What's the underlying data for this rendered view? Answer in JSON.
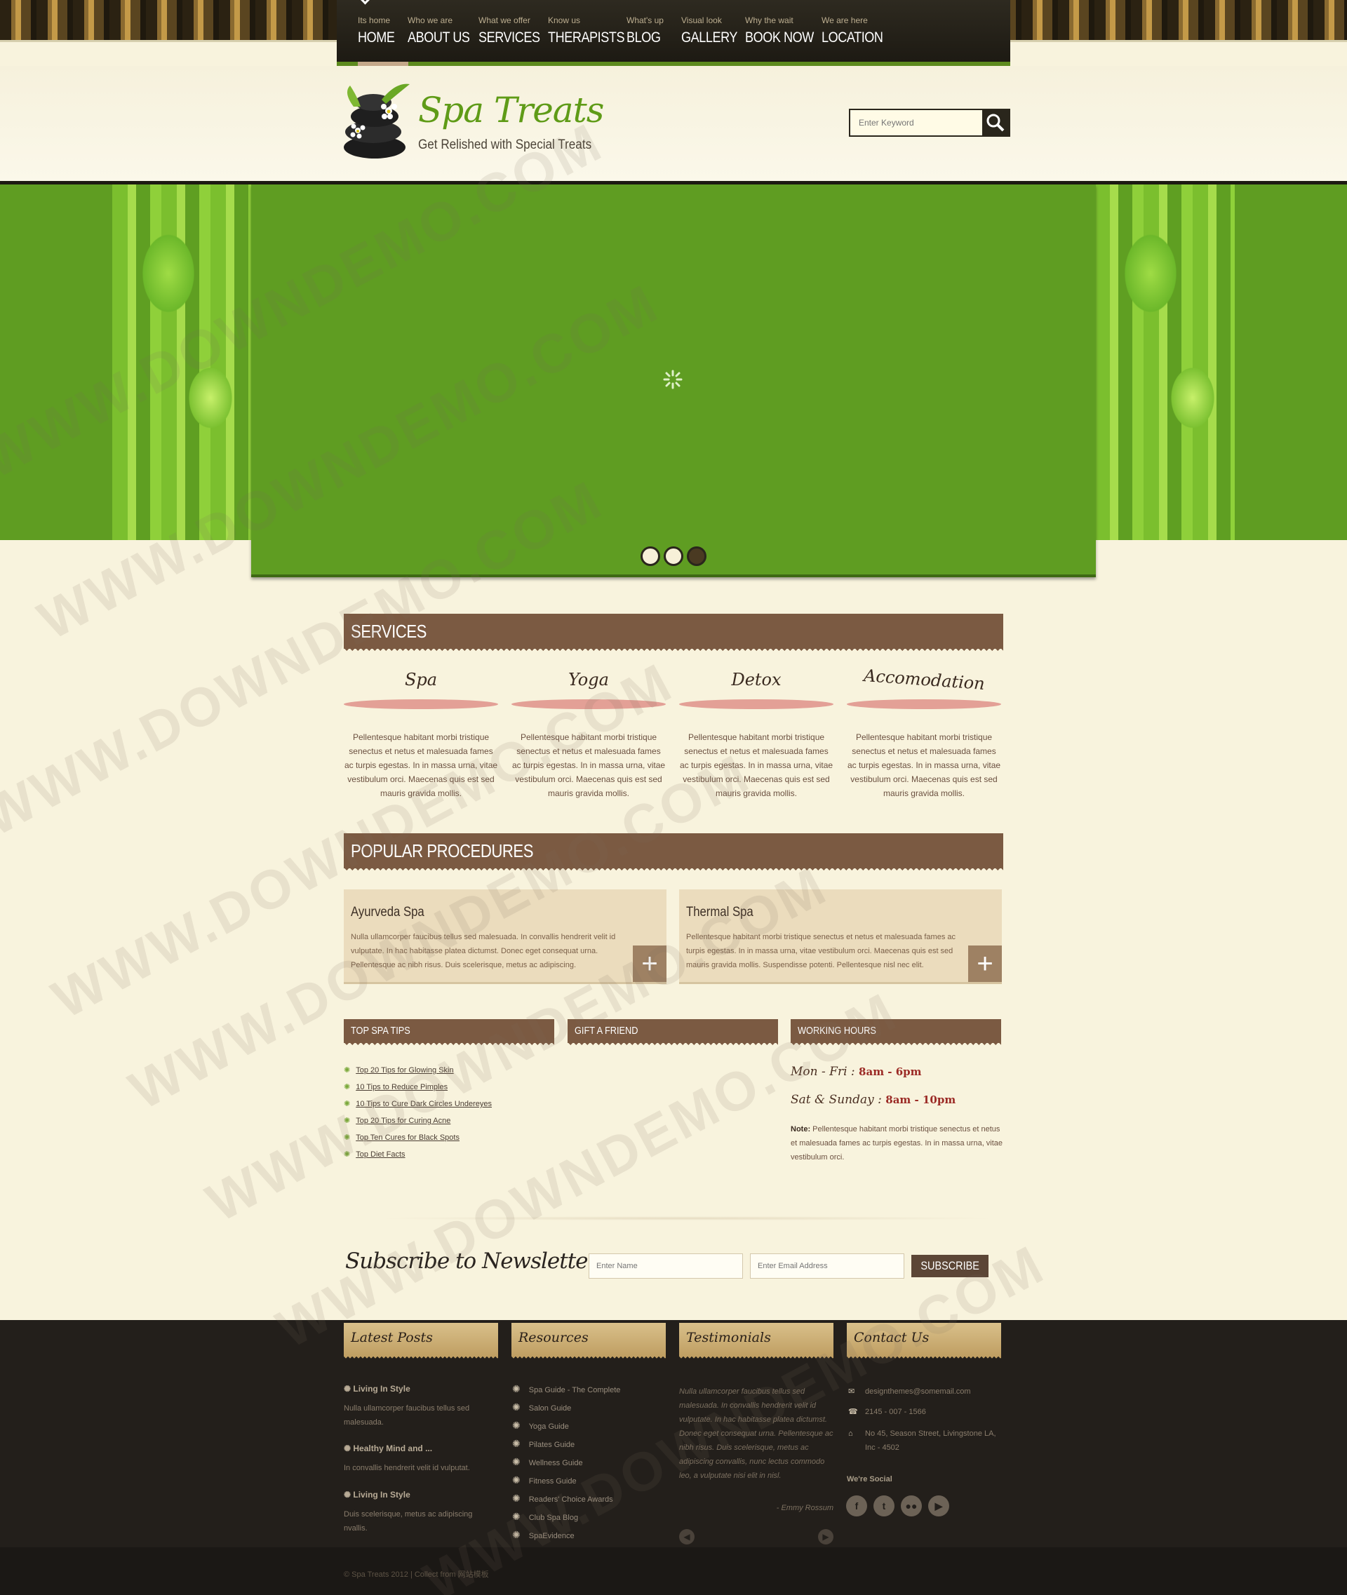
{
  "nav": {
    "items": [
      {
        "sub": "Its home",
        "label": "HOME"
      },
      {
        "sub": "Who we are",
        "label": "ABOUT US"
      },
      {
        "sub": "What we offer",
        "label": "SERVICES"
      },
      {
        "sub": "Know us",
        "label": "THERAPISTS"
      },
      {
        "sub": "What's up",
        "label": "BLOG"
      },
      {
        "sub": "Visual look",
        "label": "GALLERY"
      },
      {
        "sub": "Why the wait",
        "label": "BOOK NOW"
      },
      {
        "sub": "We are here",
        "label": "LOCATION"
      }
    ]
  },
  "brand": {
    "title": "Spa Treats",
    "tagline": "Get Relished with Special Treats"
  },
  "search": {
    "placeholder": "Enter Keyword"
  },
  "services": {
    "heading": "SERVICES",
    "items": [
      {
        "title": "Spa",
        "text": "Pellentesque habitant morbi tristique senectus et netus et malesuada fames ac turpis egestas. In in massa urna, vitae vestibulum orci. Maecenas quis est sed mauris gravida mollis."
      },
      {
        "title": "Yoga",
        "text": "Pellentesque habitant morbi tristique senectus et netus et malesuada fames ac turpis egestas. In in massa urna, vitae vestibulum orci. Maecenas quis est sed mauris gravida mollis."
      },
      {
        "title": "Detox",
        "text": "Pellentesque habitant morbi tristique senectus et netus et malesuada fames ac turpis egestas. In in massa urna, vitae vestibulum orci. Maecenas quis est sed mauris gravida mollis."
      },
      {
        "title": "Accomodation",
        "text": "Pellentesque habitant morbi tristique senectus et netus et malesuada fames ac turpis egestas. In in massa urna, vitae vestibulum orci. Maecenas quis est sed mauris gravida mollis."
      }
    ]
  },
  "procedures": {
    "heading": "POPULAR PROCEDURES",
    "items": [
      {
        "title": "Ayurveda Spa",
        "text": "Nulla ullamcorper faucibus tellus sed malesuada. In convallis hendrerit velit id vulputate. In hac habitasse platea dictumst. Donec eget consequat urna. Pellentesque ac nibh risus. Duis scelerisque, metus ac adipiscing."
      },
      {
        "title": "Thermal Spa",
        "text": "Pellentesque habitant morbi tristique senectus et netus et malesuada fames ac turpis egestas. In in massa urna, vitae vestibulum orci. Maecenas quis est sed mauris gravida mollis. Suspendisse potenti. Pellentesque nisl nec elit."
      }
    ]
  },
  "tips": {
    "heading": "TOP SPA TIPS",
    "items": [
      "Top 20 Tips for Glowing Skin",
      "10 Tips to Reduce Pimples",
      "10 Tips to Cure Dark Circles Undereyes",
      "Top 20 Tips for Curing Acne",
      "Top Ten Cures for Black Spots",
      "Top Diet Facts"
    ]
  },
  "gift": {
    "heading": "GIFT A FRIEND"
  },
  "hours": {
    "heading": "WORKING HOURS",
    "weekday_label": "Mon - Fri :",
    "weekday_time": "8am - 6pm",
    "weekend_label": "Sat & Sunday :",
    "weekend_time": "8am - 10pm",
    "note_label": "Note:",
    "note": "Pellentesque habitant morbi tristique senectus et netus et malesuada fames ac turpis egestas. In in massa urna, vitae vestibulum orci."
  },
  "newsletter": {
    "title": "Subscribe to Newsletter",
    "name_placeholder": "Enter Name",
    "email_placeholder": "Enter Email Address",
    "button": "SUBSCRIBE"
  },
  "footer": {
    "latest": {
      "heading": "Latest Posts",
      "posts": [
        {
          "title": "Living In Style",
          "text": "Nulla ullamcorper faucibus tellus sed malesuada."
        },
        {
          "title": "Healthy Mind and ...",
          "text": "In convallis hendrerit velit id vulputat."
        },
        {
          "title": "Living In Style",
          "text": "Duis scelerisque, metus ac adipiscing nvallis."
        }
      ]
    },
    "resources": {
      "heading": "Resources",
      "items": [
        "Spa Guide - The Complete",
        "Salon Guide",
        "Yoga Guide",
        "Pilates Guide",
        "Wellness Guide",
        "Fitness Guide",
        "Readers' Choice Awards",
        "Club Spa Blog",
        "SpaEvidence"
      ]
    },
    "testimonials": {
      "heading": "Testimonials",
      "text": "Nulla ullamcorper faucibus tellus sed malesuada. In convallis hendrerit velit id vulputate. In hac habitasse platea dictumst. Donec eget consequat urna. Pellentesque ac nibh risus. Duis scelerisque, metus ac adipiscing convallis, nunc lectus commodo leo, a vulputate nisi elit in nisl.",
      "author": "- Emmy Rossum"
    },
    "contact": {
      "heading": "Contact Us",
      "email": "designthemes@somemail.com",
      "phone": "2145 - 007 - 1566",
      "address": "No 45, Season Street, Livingstone LA, Inc - 4502",
      "social_label": "We're Social"
    },
    "copyright": "© Spa Treats 2012 | Collect from 网站模板"
  },
  "watermark": "WWW.DOWNDEMO.COM",
  "colors": {
    "accent_green": "#5f9d22",
    "brown_bar": "#7b5a42",
    "cream_bg": "#f8f3dd",
    "footer_bg": "#231f1b"
  }
}
